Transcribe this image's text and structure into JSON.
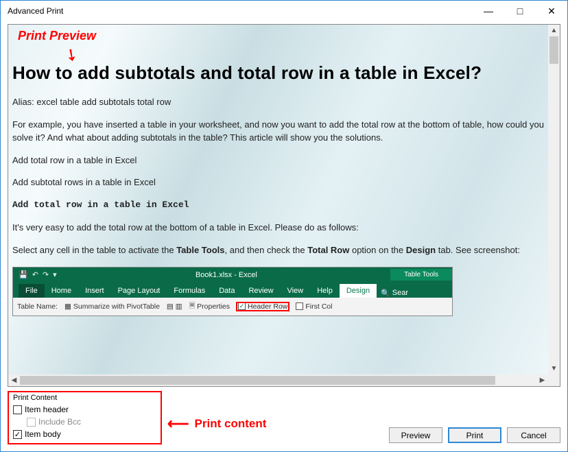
{
  "window": {
    "title": "Advanced Print"
  },
  "annotations": {
    "preview_label": "Print Preview",
    "content_label": "Print content"
  },
  "document": {
    "heading": "How to add subtotals and total row in a table in Excel?",
    "alias": "Alias: excel table add subtotals total row",
    "p1": "For example, you have inserted a table in your worksheet, and now you want to add the total row at the bottom of table, how could you solve it? And what about adding subtotals in the table? This article will show you the solutions.",
    "p2": "Add total row in a table in Excel",
    "p3": "Add subtotal rows in a table in Excel",
    "p4": "Add total row in a table in Excel",
    "p5": "It's very easy to add the total row at the bottom of a table in Excel. Please do as follows:",
    "p6_pre": "Select any cell in the table to activate the ",
    "p6_bold1": "Table Tools",
    "p6_mid": ", and then check the ",
    "p6_bold2": "Total Row",
    "p6_mid2": " option on the ",
    "p6_bold3": "Design",
    "p6_post": " tab. See screenshot:"
  },
  "ribbon": {
    "app_title": "Book1.xlsx - Excel",
    "table_tools": "Table Tools",
    "tabs": {
      "file": "File",
      "home": "Home",
      "insert": "Insert",
      "page_layout": "Page Layout",
      "formulas": "Formulas",
      "data": "Data",
      "review": "Review",
      "view": "View",
      "help": "Help",
      "design": "Design",
      "search": "Sear"
    },
    "body": {
      "table_name": "Table Name:",
      "summarize": "Summarize with PivotTable",
      "properties": "Properties",
      "header_row": "Header Row",
      "first_col": "First Col"
    }
  },
  "print_content": {
    "title": "Print Content",
    "item_header": "Item header",
    "include_bcc": "Include Bcc",
    "item_body": "Item body",
    "item_header_checked": false,
    "item_body_checked": true
  },
  "buttons": {
    "preview": "Preview",
    "print": "Print",
    "cancel": "Cancel"
  }
}
